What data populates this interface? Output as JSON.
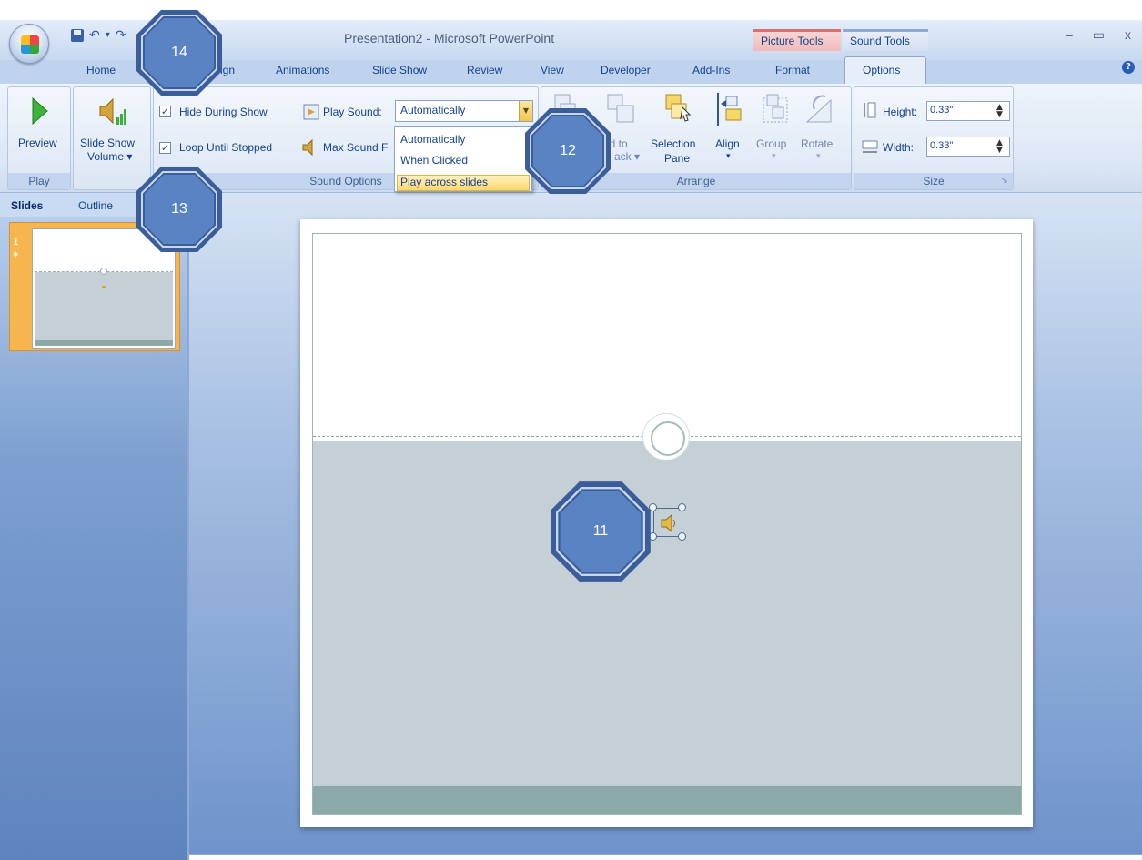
{
  "window": {
    "title": "Presentation2 - Microsoft PowerPoint",
    "contextual_tabs": [
      "Picture Tools",
      "Sound Tools"
    ],
    "controls": [
      "–",
      "▭",
      "x"
    ]
  },
  "tabs": [
    "Home",
    "Design",
    "Animations",
    "Slide Show",
    "Review",
    "View",
    "Developer",
    "Add-Ins",
    "Format",
    "Options"
  ],
  "tabs_visible": {
    "home": "Home",
    "design_partial": "sign",
    "animations": "Animations",
    "slide_show": "Slide Show",
    "review": "Review",
    "view": "View",
    "developer": "Developer",
    "add_ins": "Add-Ins",
    "format": "Format",
    "options": "Options"
  },
  "ribbon": {
    "play": {
      "preview": "Preview",
      "group": "Play"
    },
    "slideshow_volume": {
      "line1": "Slide Show",
      "line2": "Volume ▾"
    },
    "sound_options": {
      "hide_during_show": "Hide During Show",
      "loop_until_stopped": "Loop Until Stopped",
      "play_sound_label": "Play Sound:",
      "play_sound_value": "Automatically",
      "max_sound": "Max Sound F",
      "group": "Sound Options"
    },
    "arrange": {
      "bring_forward": "",
      "send_to_back_line1": "nd to",
      "send_to_back_line2": "ack ▾",
      "selection_pane_line1": "Selection",
      "selection_pane_line2": "Pane",
      "align": "Align",
      "align_arrow": "▾",
      "group_btn": "Group",
      "rotate": "Rotate",
      "group": "Arrange"
    },
    "size": {
      "height_label": "Height:",
      "height_value": "0.33\"",
      "width_label": "Width:",
      "width_value": "0.33\"",
      "group": "Size"
    }
  },
  "dropdown": {
    "options": [
      "Automatically",
      "When Clicked",
      "Play across slides"
    ],
    "selected": "Play across slides"
  },
  "left_panel": {
    "tabs": [
      "Slides",
      "Outline"
    ],
    "slide_number": "1"
  },
  "callouts": {
    "c11": "11",
    "c12": "12",
    "c13": "13",
    "c14": "14"
  },
  "colors": {
    "callout_fill": "#5a83c3",
    "callout_ring": "#3b5e9a",
    "slide_lower": "#c5d0d6",
    "slide_bar": "#8aa9a8"
  }
}
